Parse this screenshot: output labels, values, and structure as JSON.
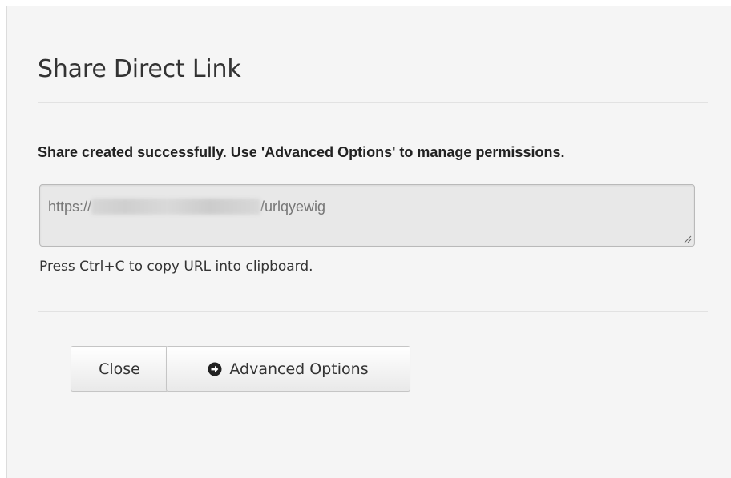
{
  "dialog": {
    "title": "Share Direct Link",
    "message": "Share created successfully. Use 'Advanced Options' to manage permissions.",
    "url": {
      "prefix": "https://",
      "suffix": "/urlqyewig"
    },
    "hint": "Press Ctrl+C to copy URL into clipboard.",
    "buttons": {
      "close_label": "Close",
      "advanced_label": "Advanced Options"
    }
  },
  "icons": {
    "advanced": "circle-arrow-right-icon",
    "resize": "resize-grip-icon"
  }
}
